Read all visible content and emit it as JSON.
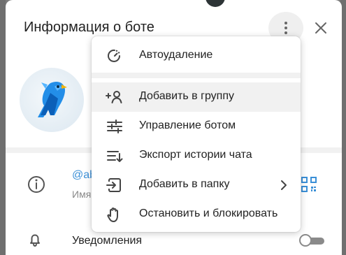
{
  "window": {
    "title": "Информация о боте"
  },
  "profile": {
    "username": "@ab",
    "username_hint": "Имя"
  },
  "settings": {
    "notifications_label": "Уведомления"
  },
  "menu": {
    "items": [
      {
        "label": "Автоудаление",
        "icon": "timer-icon",
        "active": false
      },
      {
        "label": "Добавить в группу",
        "icon": "add-user-icon",
        "active": true
      },
      {
        "label": "Управление ботом",
        "icon": "sliders-icon",
        "active": false
      },
      {
        "label": "Экспорт истории чата",
        "icon": "export-list-icon",
        "active": false
      },
      {
        "label": "Добавить в папку",
        "icon": "folder-add-icon",
        "active": false,
        "has_submenu": true
      },
      {
        "label": "Остановить и блокировать",
        "icon": "stop-hand-icon",
        "active": false
      }
    ]
  },
  "colors": {
    "accent": "#3a8fd7",
    "text": "#222222",
    "muted": "#8a8a8a",
    "hover": "#f1f1f1"
  }
}
